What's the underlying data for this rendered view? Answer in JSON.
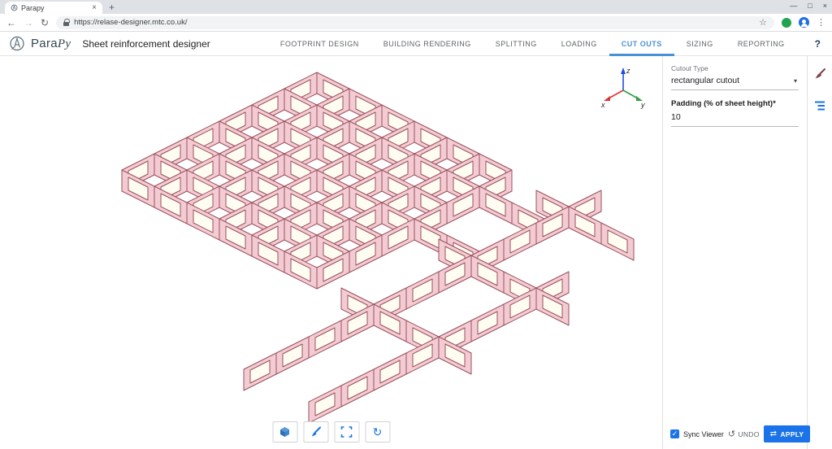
{
  "browser": {
    "tab_title": "Parapy",
    "url": "https://relase-designer.mtc.co.uk/"
  },
  "icons": {
    "back": "←",
    "forward": "→",
    "reload": "↻",
    "bookmark_star": "☆",
    "menu_dots": "⋮",
    "tab_close": "×",
    "new_tab": "+",
    "minimize": "—",
    "maximize": "□",
    "close": "×",
    "help": "?",
    "caret_down": "▾",
    "check": "✓",
    "undo_arrow": "↺",
    "apply_arrows": "⇄",
    "refresh": "↻"
  },
  "header": {
    "brand_a": "Para",
    "brand_b": "Py",
    "app_title": "Sheet reinforcement designer",
    "tabs": [
      {
        "label": "FOOTPRINT DESIGN",
        "active": false
      },
      {
        "label": "BUILDING RENDERING",
        "active": false
      },
      {
        "label": "SPLITTING",
        "active": false
      },
      {
        "label": "LOADING",
        "active": false
      },
      {
        "label": "CUT OUTS",
        "active": true
      },
      {
        "label": "SIZING",
        "active": false
      },
      {
        "label": "REPORTING",
        "active": false
      }
    ]
  },
  "viewer": {
    "axis": {
      "x": "x",
      "y": "y",
      "z": "z"
    },
    "colors": {
      "sheet_fill": "#f3ccd3",
      "sheet_stroke": "#9b4f5c",
      "cutout_fill": "#fffdf2",
      "axis_x": "#e03131",
      "axis_y": "#2f9e44",
      "axis_z": "#1f4de0"
    }
  },
  "panel": {
    "cutout_type_label": "Cutout Type",
    "cutout_type_value": "rectangular cutout",
    "padding_label": "Padding (% of sheet height)*",
    "padding_value": "10"
  },
  "footer": {
    "sync_viewer": "Sync Viewer",
    "undo": "UNDO",
    "apply": "APPLY"
  }
}
